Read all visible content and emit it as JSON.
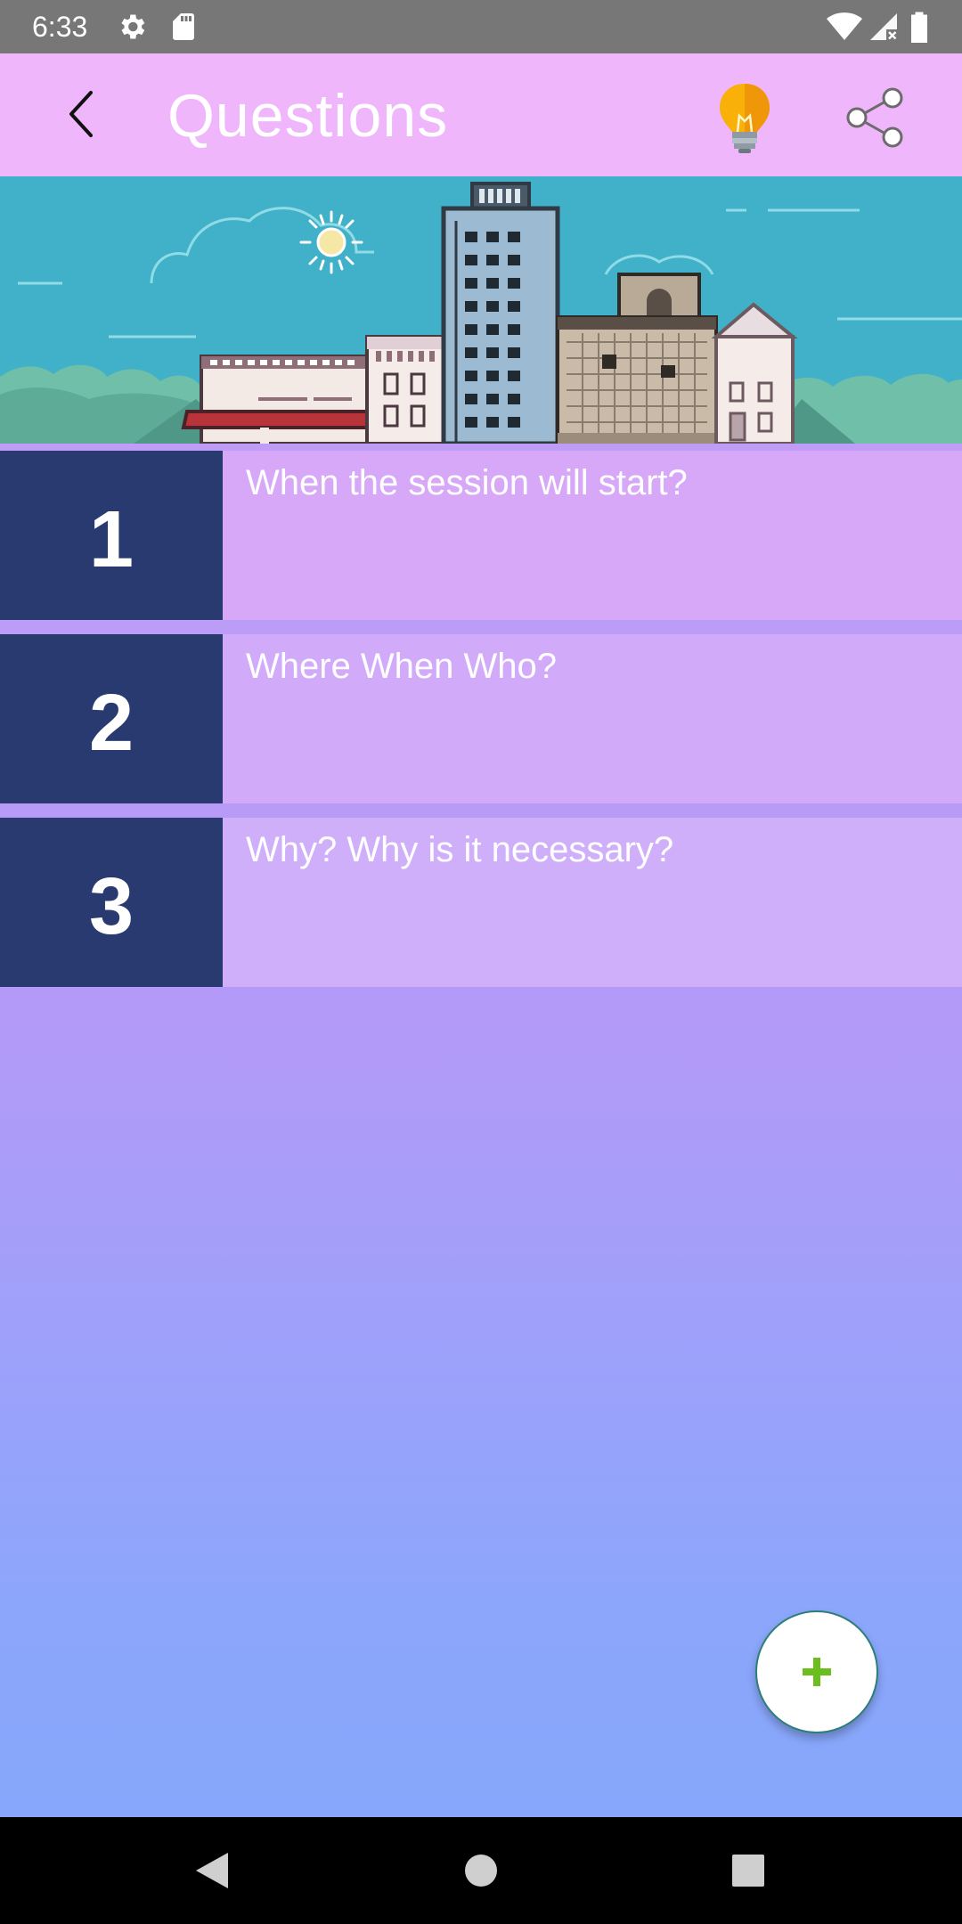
{
  "status_bar": {
    "time": "6:33",
    "icons": [
      "gear-icon",
      "sd-card-icon",
      "wifi-icon",
      "cell-signal-icon",
      "battery-icon"
    ]
  },
  "app_bar": {
    "title": "Questions",
    "icons": [
      "back-arrow-icon",
      "lightbulb-icon",
      "share-icon"
    ],
    "background_color": "#efb6fb"
  },
  "banner": {
    "icons": [
      "sun-icon",
      "cloud-icon",
      "city-skyline"
    ]
  },
  "questions": [
    {
      "number": "1",
      "text": "When the session will start?"
    },
    {
      "number": "2",
      "text": "Where When Who?"
    },
    {
      "number": "3",
      "text": "Why? Why is it necessary?"
    }
  ],
  "fab": {
    "icon": "plus-icon",
    "icon_color": "#6abf1d"
  },
  "nav_bar": {
    "icons": [
      "nav-back-icon",
      "nav-home-icon",
      "nav-recents-icon"
    ]
  },
  "colors": {
    "number_box": "#283a70",
    "status_bar": "#777777"
  }
}
